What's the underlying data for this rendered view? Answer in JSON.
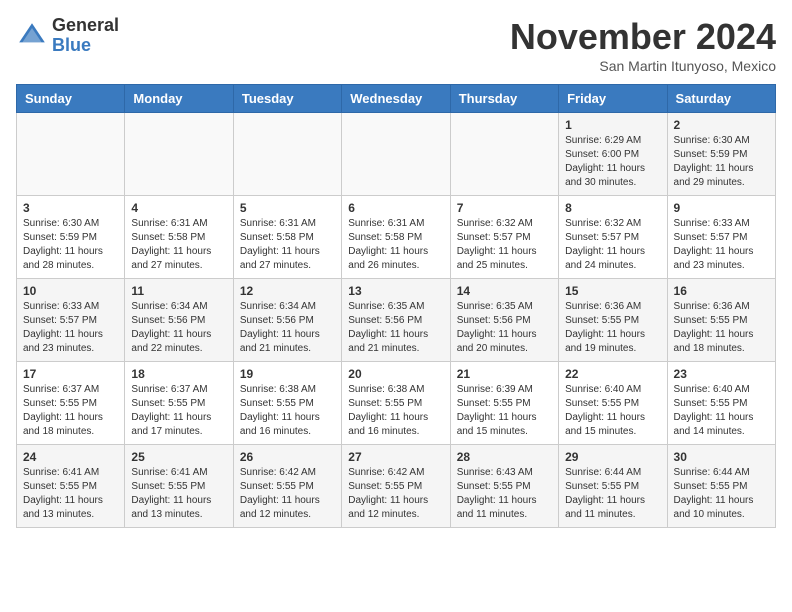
{
  "header": {
    "logo_general": "General",
    "logo_blue": "Blue",
    "month_title": "November 2024",
    "location": "San Martin Itunyoso, Mexico"
  },
  "weekdays": [
    "Sunday",
    "Monday",
    "Tuesday",
    "Wednesday",
    "Thursday",
    "Friday",
    "Saturday"
  ],
  "weeks": [
    [
      {
        "day": "",
        "info": ""
      },
      {
        "day": "",
        "info": ""
      },
      {
        "day": "",
        "info": ""
      },
      {
        "day": "",
        "info": ""
      },
      {
        "day": "",
        "info": ""
      },
      {
        "day": "1",
        "info": "Sunrise: 6:29 AM\nSunset: 6:00 PM\nDaylight: 11 hours and 30 minutes."
      },
      {
        "day": "2",
        "info": "Sunrise: 6:30 AM\nSunset: 5:59 PM\nDaylight: 11 hours and 29 minutes."
      }
    ],
    [
      {
        "day": "3",
        "info": "Sunrise: 6:30 AM\nSunset: 5:59 PM\nDaylight: 11 hours and 28 minutes."
      },
      {
        "day": "4",
        "info": "Sunrise: 6:31 AM\nSunset: 5:58 PM\nDaylight: 11 hours and 27 minutes."
      },
      {
        "day": "5",
        "info": "Sunrise: 6:31 AM\nSunset: 5:58 PM\nDaylight: 11 hours and 27 minutes."
      },
      {
        "day": "6",
        "info": "Sunrise: 6:31 AM\nSunset: 5:58 PM\nDaylight: 11 hours and 26 minutes."
      },
      {
        "day": "7",
        "info": "Sunrise: 6:32 AM\nSunset: 5:57 PM\nDaylight: 11 hours and 25 minutes."
      },
      {
        "day": "8",
        "info": "Sunrise: 6:32 AM\nSunset: 5:57 PM\nDaylight: 11 hours and 24 minutes."
      },
      {
        "day": "9",
        "info": "Sunrise: 6:33 AM\nSunset: 5:57 PM\nDaylight: 11 hours and 23 minutes."
      }
    ],
    [
      {
        "day": "10",
        "info": "Sunrise: 6:33 AM\nSunset: 5:57 PM\nDaylight: 11 hours and 23 minutes."
      },
      {
        "day": "11",
        "info": "Sunrise: 6:34 AM\nSunset: 5:56 PM\nDaylight: 11 hours and 22 minutes."
      },
      {
        "day": "12",
        "info": "Sunrise: 6:34 AM\nSunset: 5:56 PM\nDaylight: 11 hours and 21 minutes."
      },
      {
        "day": "13",
        "info": "Sunrise: 6:35 AM\nSunset: 5:56 PM\nDaylight: 11 hours and 21 minutes."
      },
      {
        "day": "14",
        "info": "Sunrise: 6:35 AM\nSunset: 5:56 PM\nDaylight: 11 hours and 20 minutes."
      },
      {
        "day": "15",
        "info": "Sunrise: 6:36 AM\nSunset: 5:55 PM\nDaylight: 11 hours and 19 minutes."
      },
      {
        "day": "16",
        "info": "Sunrise: 6:36 AM\nSunset: 5:55 PM\nDaylight: 11 hours and 18 minutes."
      }
    ],
    [
      {
        "day": "17",
        "info": "Sunrise: 6:37 AM\nSunset: 5:55 PM\nDaylight: 11 hours and 18 minutes."
      },
      {
        "day": "18",
        "info": "Sunrise: 6:37 AM\nSunset: 5:55 PM\nDaylight: 11 hours and 17 minutes."
      },
      {
        "day": "19",
        "info": "Sunrise: 6:38 AM\nSunset: 5:55 PM\nDaylight: 11 hours and 16 minutes."
      },
      {
        "day": "20",
        "info": "Sunrise: 6:38 AM\nSunset: 5:55 PM\nDaylight: 11 hours and 16 minutes."
      },
      {
        "day": "21",
        "info": "Sunrise: 6:39 AM\nSunset: 5:55 PM\nDaylight: 11 hours and 15 minutes."
      },
      {
        "day": "22",
        "info": "Sunrise: 6:40 AM\nSunset: 5:55 PM\nDaylight: 11 hours and 15 minutes."
      },
      {
        "day": "23",
        "info": "Sunrise: 6:40 AM\nSunset: 5:55 PM\nDaylight: 11 hours and 14 minutes."
      }
    ],
    [
      {
        "day": "24",
        "info": "Sunrise: 6:41 AM\nSunset: 5:55 PM\nDaylight: 11 hours and 13 minutes."
      },
      {
        "day": "25",
        "info": "Sunrise: 6:41 AM\nSunset: 5:55 PM\nDaylight: 11 hours and 13 minutes."
      },
      {
        "day": "26",
        "info": "Sunrise: 6:42 AM\nSunset: 5:55 PM\nDaylight: 11 hours and 12 minutes."
      },
      {
        "day": "27",
        "info": "Sunrise: 6:42 AM\nSunset: 5:55 PM\nDaylight: 11 hours and 12 minutes."
      },
      {
        "day": "28",
        "info": "Sunrise: 6:43 AM\nSunset: 5:55 PM\nDaylight: 11 hours and 11 minutes."
      },
      {
        "day": "29",
        "info": "Sunrise: 6:44 AM\nSunset: 5:55 PM\nDaylight: 11 hours and 11 minutes."
      },
      {
        "day": "30",
        "info": "Sunrise: 6:44 AM\nSunset: 5:55 PM\nDaylight: 11 hours and 10 minutes."
      }
    ]
  ]
}
